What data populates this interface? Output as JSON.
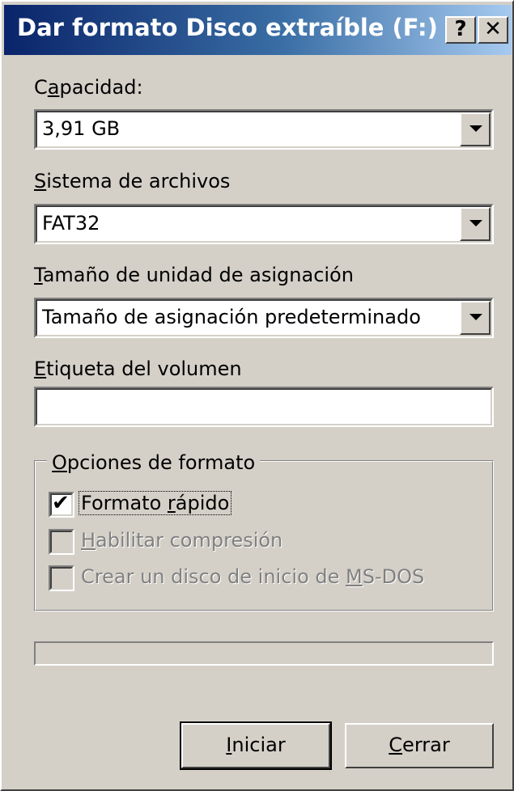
{
  "window": {
    "title": "Dar formato Disco extraíble (F:)",
    "help_button": "?",
    "close_button": "✕"
  },
  "capacity": {
    "label_acc": "C",
    "label_acc2": "a",
    "label_rest": "pacidad:",
    "value": "3,91 GB"
  },
  "filesystem": {
    "label_acc": "S",
    "label_rest": "istema de archivos",
    "value": "FAT32"
  },
  "allocation": {
    "label_acc": "T",
    "label_rest": "amaño de unidad de asignación",
    "value": "Tamaño de asignación predeterminado"
  },
  "volume_label": {
    "label_acc": "E",
    "label_rest": "tiqueta del volumen",
    "value": ""
  },
  "format_options": {
    "legend_acc": "O",
    "legend_rest": "pciones de formato",
    "quick_format": {
      "pre": "Formato ",
      "acc": "r",
      "post": "ápido",
      "checked": true
    },
    "enable_compression": {
      "acc": "H",
      "post": "abilitar compresión",
      "checked": false,
      "enabled": false
    },
    "msdos_startup": {
      "pre": "Crear un disco de inicio de ",
      "acc": "M",
      "post": "S-DOS",
      "checked": false,
      "enabled": false
    }
  },
  "progress": {
    "value": 0
  },
  "buttons": {
    "start": {
      "acc": "I",
      "rest": "niciar"
    },
    "close": {
      "acc": "C",
      "rest": "errar"
    }
  },
  "icons": {
    "dropdown": "chevron-down-icon",
    "check": "check-icon"
  }
}
